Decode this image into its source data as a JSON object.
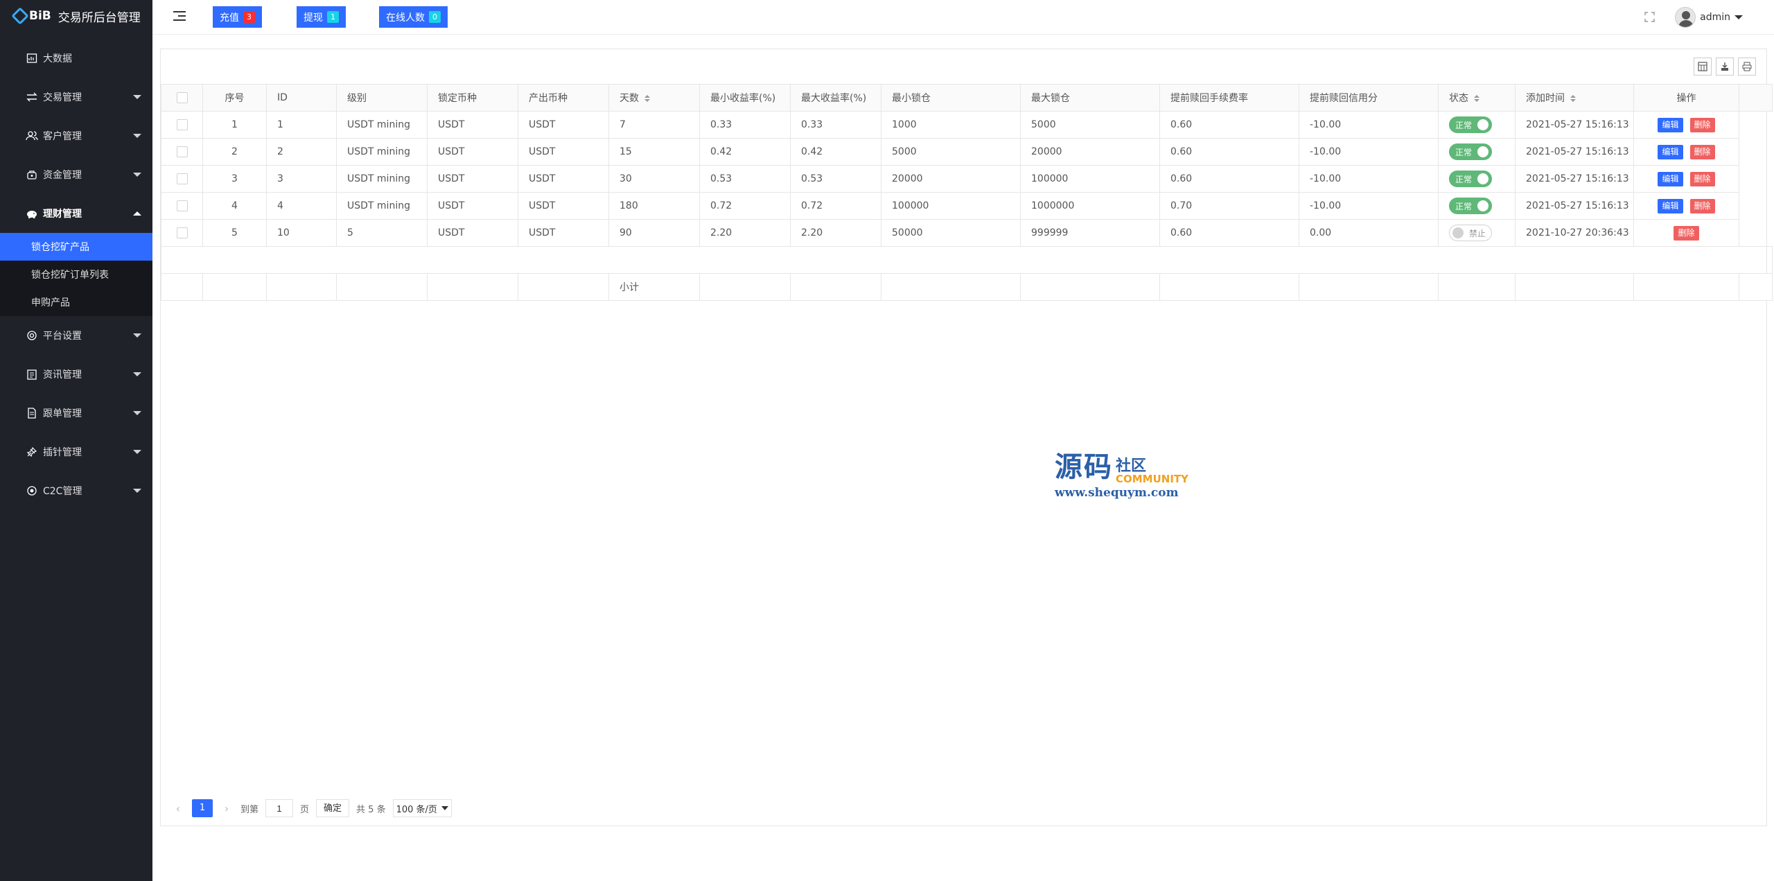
{
  "brand": {
    "logo": "BiB",
    "title": "交易所后台管理"
  },
  "sidebar": {
    "items": [
      {
        "label": "大数据",
        "icon": "dashboard-icon",
        "has_caret": false
      },
      {
        "label": "交易管理",
        "icon": "exchange-icon",
        "has_caret": true
      },
      {
        "label": "客户管理",
        "icon": "users-icon",
        "has_caret": true
      },
      {
        "label": "资金管理",
        "icon": "wallet-icon",
        "has_caret": true
      },
      {
        "label": "理财管理",
        "icon": "piggy-bank-icon",
        "has_caret": true,
        "open": true
      },
      {
        "label": "平台设置",
        "icon": "settings-icon",
        "has_caret": true
      },
      {
        "label": "资讯管理",
        "icon": "news-icon",
        "has_caret": true
      },
      {
        "label": "跟单管理",
        "icon": "document-icon",
        "has_caret": true
      },
      {
        "label": "插针管理",
        "icon": "pin-icon",
        "has_caret": true
      },
      {
        "label": "C2C管理",
        "icon": "c2c-icon",
        "has_caret": true
      }
    ],
    "submenu": [
      {
        "label": "锁仓挖矿产品",
        "active": true
      },
      {
        "label": "锁仓挖矿订单列表",
        "active": false
      },
      {
        "label": "申购产品",
        "active": false
      }
    ]
  },
  "header": {
    "pills": [
      {
        "label": "充值",
        "count": "3",
        "badge_color": "#ff2d2d"
      },
      {
        "label": "提现",
        "count": "1",
        "badge_color": "#17d3e6"
      },
      {
        "label": "在线人数",
        "count": "0",
        "badge_color": "#17d3e6"
      }
    ],
    "user": "admin"
  },
  "table": {
    "columns": [
      "",
      "序号",
      "ID",
      "级别",
      "锁定币种",
      "产出币种",
      "天数",
      "最小收益率(%)",
      "最大收益率(%)",
      "最小锁仓",
      "最大锁仓",
      "提前赎回手续费率",
      "提前赎回信用分",
      "状态",
      "添加时间",
      "操作"
    ],
    "sortable": [
      "天数",
      "状态",
      "添加时间"
    ],
    "rows": [
      {
        "seq": "1",
        "id": "1",
        "level": "USDT mining",
        "lock_coin": "USDT",
        "out_coin": "USDT",
        "days": "7",
        "min_rate": "0.33",
        "max_rate": "0.33",
        "min_lock": "1000",
        "max_lock": "5000",
        "fee_rate": "0.60",
        "credit": "-10.00",
        "status": "正常",
        "status_on": true,
        "time": "2021-05-27 15:16:13",
        "edit": "编辑",
        "del": "删除"
      },
      {
        "seq": "2",
        "id": "2",
        "level": "USDT mining",
        "lock_coin": "USDT",
        "out_coin": "USDT",
        "days": "15",
        "min_rate": "0.42",
        "max_rate": "0.42",
        "min_lock": "5000",
        "max_lock": "20000",
        "fee_rate": "0.60",
        "credit": "-10.00",
        "status": "正常",
        "status_on": true,
        "time": "2021-05-27 15:16:13",
        "edit": "编辑",
        "del": "删除"
      },
      {
        "seq": "3",
        "id": "3",
        "level": "USDT mining",
        "lock_coin": "USDT",
        "out_coin": "USDT",
        "days": "30",
        "min_rate": "0.53",
        "max_rate": "0.53",
        "min_lock": "20000",
        "max_lock": "100000",
        "fee_rate": "0.60",
        "credit": "-10.00",
        "status": "正常",
        "status_on": true,
        "time": "2021-05-27 15:16:13",
        "edit": "编辑",
        "del": "删除"
      },
      {
        "seq": "4",
        "id": "4",
        "level": "USDT mining",
        "lock_coin": "USDT",
        "out_coin": "USDT",
        "days": "180",
        "min_rate": "0.72",
        "max_rate": "0.72",
        "min_lock": "100000",
        "max_lock": "1000000",
        "fee_rate": "0.70",
        "credit": "-10.00",
        "status": "正常",
        "status_on": true,
        "time": "2021-05-27 15:16:13",
        "edit": "编辑",
        "del": "删除"
      },
      {
        "seq": "5",
        "id": "10",
        "level": "5",
        "lock_coin": "USDT",
        "out_coin": "USDT",
        "days": "90",
        "min_rate": "2.20",
        "max_rate": "2.20",
        "min_lock": "50000",
        "max_lock": "999999",
        "fee_rate": "0.60",
        "credit": "0.00",
        "status": "禁止",
        "status_on": false,
        "time": "2021-10-27 20:36:43",
        "edit": "",
        "del": "删除"
      }
    ],
    "subtotal_label": "小计"
  },
  "watermark": {
    "big": "源码",
    "small": "社区",
    "community": "COMMUNITY",
    "url": "www.shequym.com"
  },
  "pager": {
    "current": "1",
    "goto_label": "到第",
    "goto_value": "1",
    "page_label": "页",
    "confirm": "确定",
    "total": "共 5 条",
    "per_page": "100 条/页"
  }
}
